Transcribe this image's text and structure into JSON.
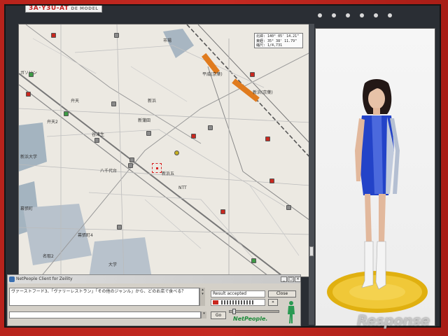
{
  "header": {
    "logo_main": "3A·Y3U-AT",
    "logo_sub": "DE MODEL"
  },
  "map": {
    "coordinates": {
      "line1": "北緯: 140° 05' 14.21\"",
      "line2": "東経: 35° 38' 11.79\"",
      "line3": "縮尺: 1/4,731"
    },
    "labels": [
      "市場",
      "平成(京葉)",
      "新浜(京葉)",
      "新浜",
      "新蒲田",
      "弁天",
      "弁天2",
      "新浜大学",
      "八千代台",
      "新浜五",
      "NTT",
      "幕張町",
      "幕張町4",
      "大学",
      "名取2",
      "谷津生",
      "ガソリン"
    ]
  },
  "client": {
    "title": "NetPeople Client for Zeility",
    "message": "ヴァーストフード3、「ヴァリーレストラン」「その他のジャンル」から、どのお店で食べる？",
    "input_value": "",
    "status_text": "Result accepted",
    "close_label": "Close",
    "go_label": "Go",
    "brand": "NetPeople."
  },
  "watermark": "Response",
  "colors": {
    "frame": "#c42a22",
    "map_bg": "#ece9e2",
    "rail": "#e07b1e",
    "brand_green": "#1d8a3a"
  },
  "icons": {
    "app": "netpeople-app-icon",
    "agent": "agent-figure-icon"
  }
}
